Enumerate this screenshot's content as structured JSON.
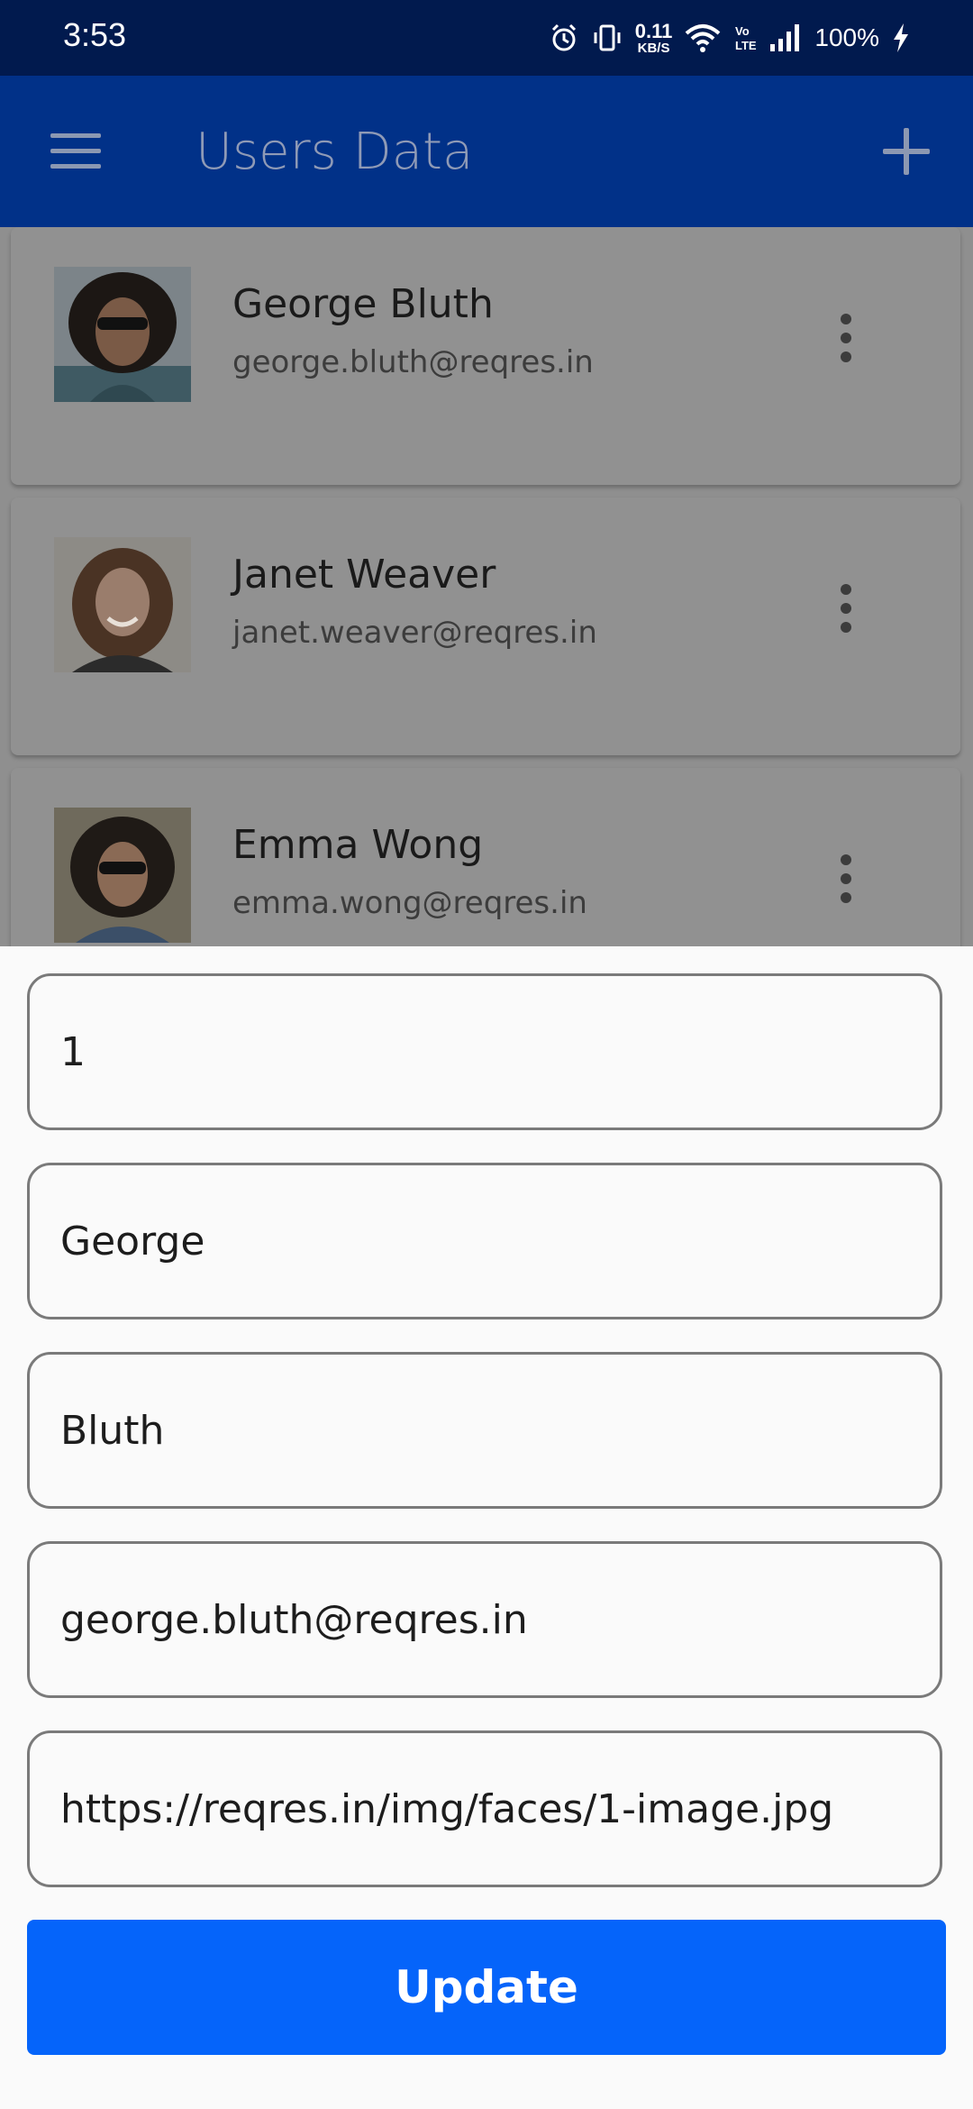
{
  "status_bar": {
    "time": "3:53",
    "net_speed_value": "0.11",
    "net_speed_unit": "KB/S",
    "volte_label": "Vo LTE",
    "battery": "100%"
  },
  "app_bar": {
    "title": "Users Data",
    "menu_icon": "hamburger-menu-icon",
    "add_icon": "plus-icon"
  },
  "users": [
    {
      "name": "George Bluth",
      "email": "george.bluth@reqres.in"
    },
    {
      "name": "Janet Weaver",
      "email": "janet.weaver@reqres.in"
    },
    {
      "name": "Emma Wong",
      "email": "emma.wong@reqres.in"
    }
  ],
  "form": {
    "id_value": "1",
    "first_name_value": "George",
    "last_name_value": "Bluth",
    "email_value": "george.bluth@reqres.in",
    "avatar_url_value": "https://reqres.in/img/faces/1-image.jpg",
    "update_label": "Update"
  },
  "colors": {
    "status_bar": "#011a4e",
    "app_bar": "#013188",
    "update_button": "#0564fa",
    "sheet_background": "#fafafa"
  }
}
